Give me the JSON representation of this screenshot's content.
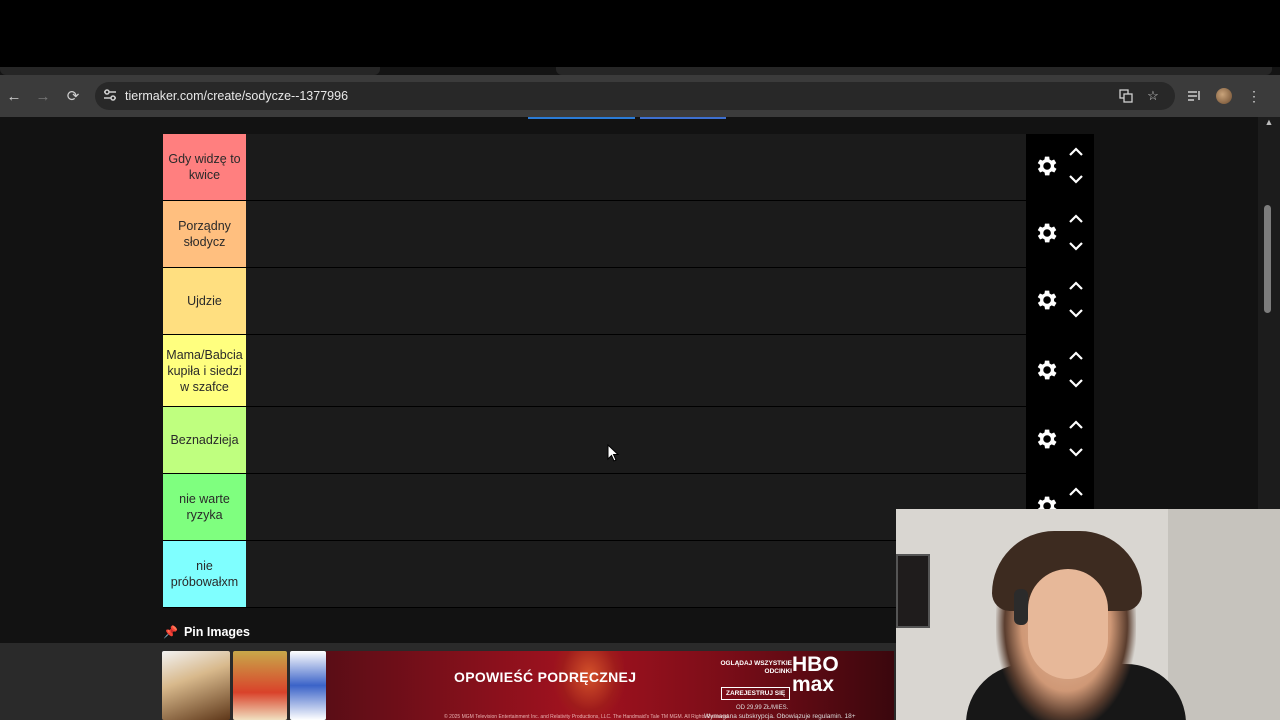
{
  "browser": {
    "url": "tiermaker.com/create/sodycze--1377996",
    "nav": {
      "back": "←",
      "forward": "→",
      "reload": "⟳"
    },
    "icons": [
      "site-settings-icon",
      "translate-icon",
      "bookmark-star-icon",
      "media-control-icon",
      "profile-avatar",
      "more-menu-icon"
    ]
  },
  "tiers": [
    {
      "label": "Gdy widzę to kwice",
      "color": "#ff7f7f"
    },
    {
      "label": "Porządny słodycz",
      "color": "#ffbf7f"
    },
    {
      "label": "Ujdzie",
      "color": "#ffdf80"
    },
    {
      "label": "Mama/Babcia kupiła i siedzi w szafce",
      "color": "#ffff7f"
    },
    {
      "label": "Beznadzieja",
      "color": "#bfff7f"
    },
    {
      "label": "nie warte ryzyka",
      "color": "#7fff7f"
    },
    {
      "label": "nie próbowałxm",
      "color": "#7fffff"
    }
  ],
  "pin": {
    "label": "Pin Images"
  },
  "ad": {
    "headline": "OPOWIEŚĆ PODRĘCZNEJ",
    "tagline": "OGLĄDAJ WSZYSTKIE ODCINKI",
    "brand_line1": "HBO",
    "brand_line2": "max",
    "cta": "ZAREJESTRUJ SIĘ",
    "price": "OD 29,99 ZŁ/MIES.",
    "fine_print": "Wymagana subskrypcja. Obowiązuje regulamin. 18+",
    "legal": "© 2025 MGM Television Entertainment Inc. and Relativity Productions, LLC. The Handmaid's Tale TM MGM. All Rights Reserved."
  }
}
